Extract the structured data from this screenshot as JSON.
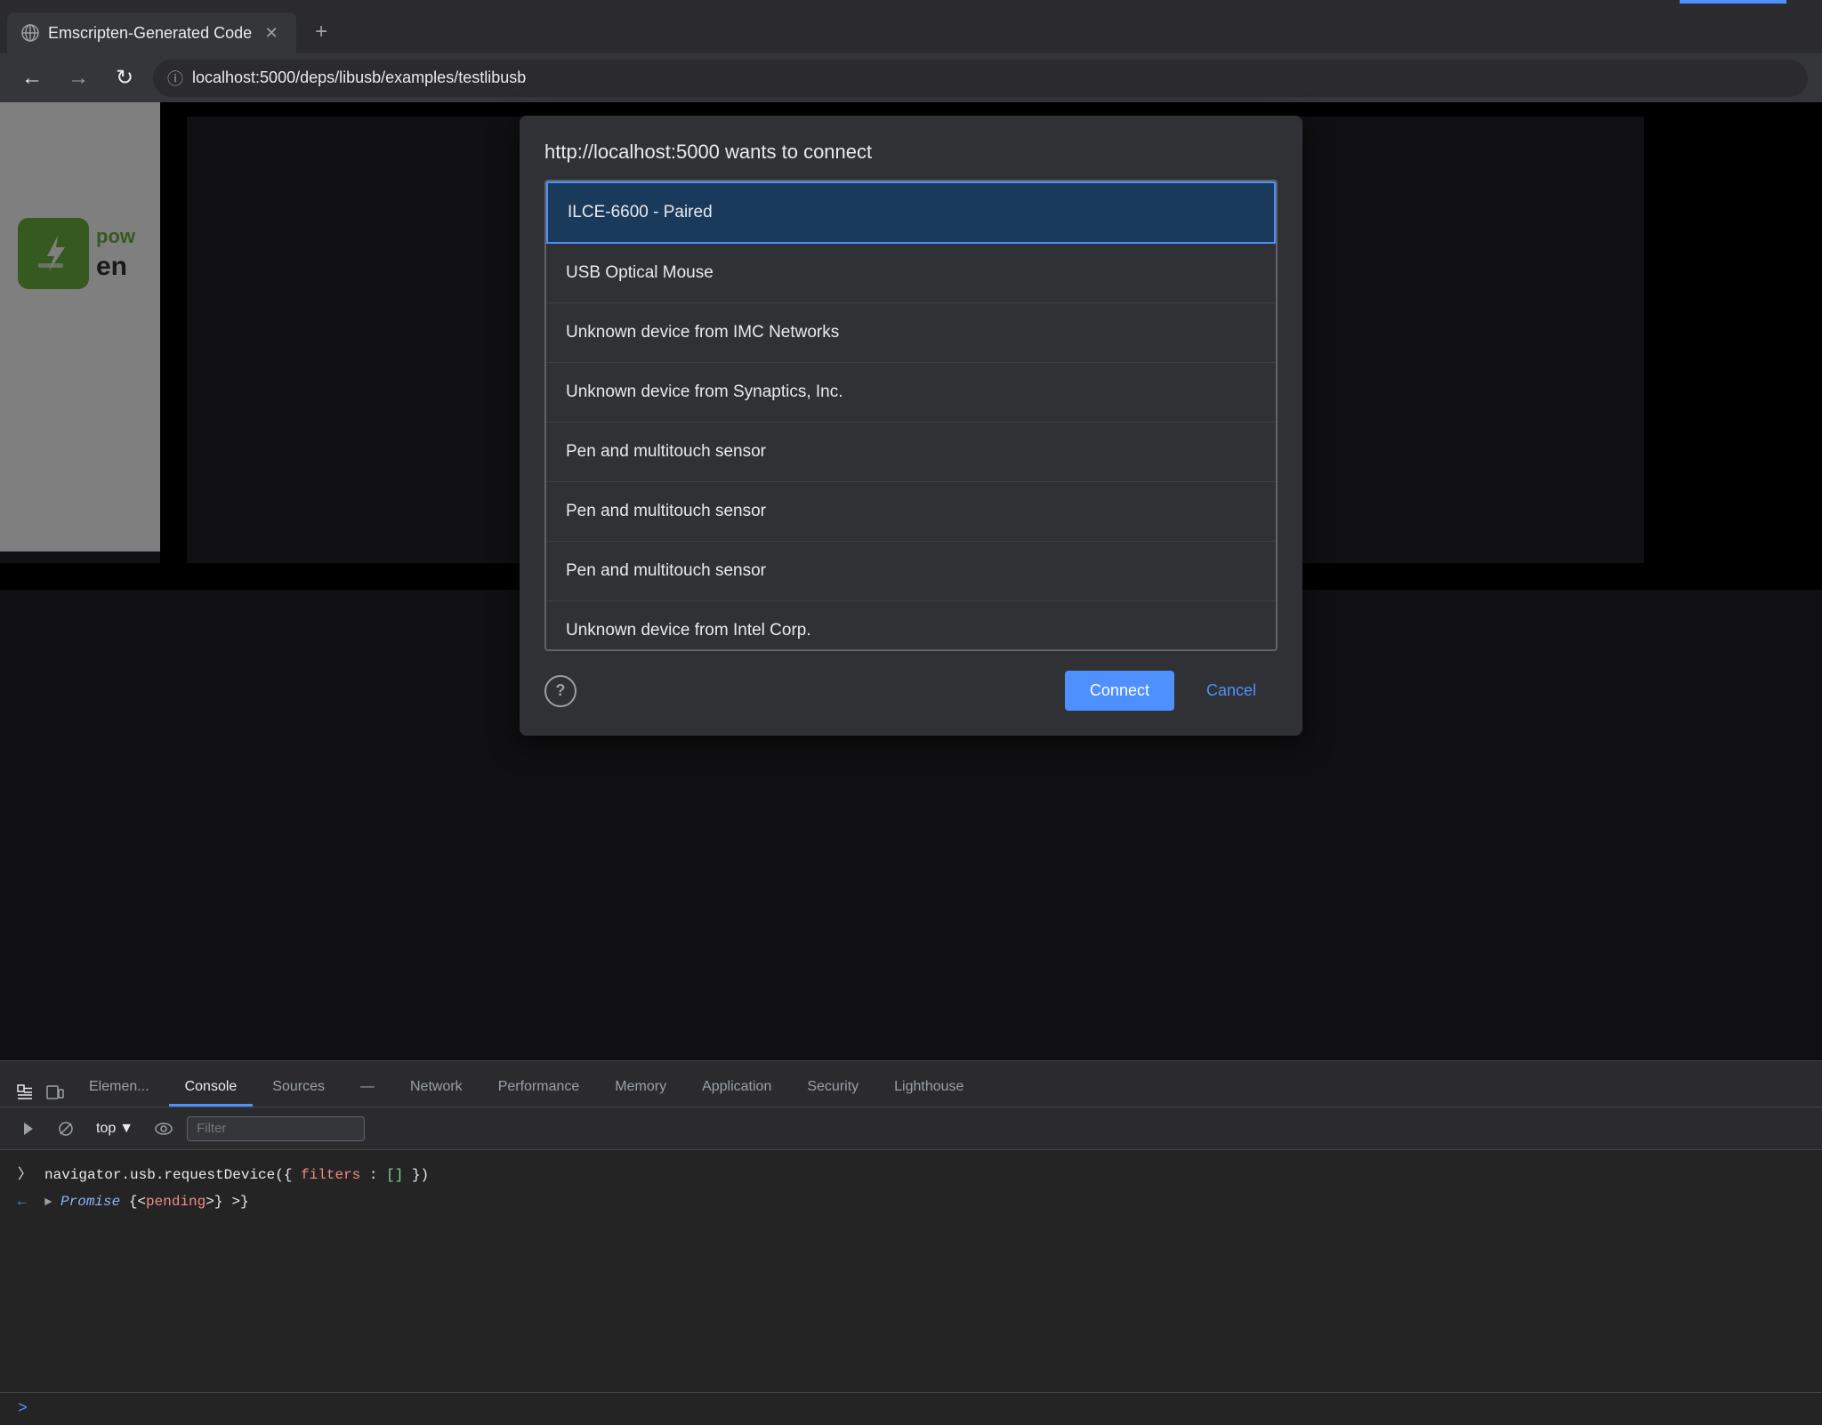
{
  "browser": {
    "tab_title": "Emscripten-Generated Code",
    "address": "localhost:5000/deps/libusb/examples/testlibusb",
    "address_prefix": "localhost:",
    "address_full": "localhost:5000/deps/libusb/examples/testlibusb"
  },
  "dialog": {
    "title": "http://localhost:5000 wants to connect",
    "devices": [
      {
        "name": "ILCE-6600 - Paired",
        "selected": true
      },
      {
        "name": "USB Optical Mouse",
        "selected": false
      },
      {
        "name": "Unknown device from IMC Networks",
        "selected": false
      },
      {
        "name": "Unknown device from Synaptics, Inc.",
        "selected": false
      },
      {
        "name": "Pen and multitouch sensor",
        "selected": false
      },
      {
        "name": "Pen and multitouch sensor",
        "selected": false
      },
      {
        "name": "Pen and multitouch sensor",
        "selected": false
      },
      {
        "name": "Unknown device from Intel Corp.",
        "selected": false
      }
    ],
    "connect_button": "Connect",
    "cancel_button": "Cancel"
  },
  "devtools": {
    "tabs": [
      {
        "label": "Elemen...",
        "active": false
      },
      {
        "label": "Console",
        "active": true
      },
      {
        "label": "Sources",
        "active": false
      },
      {
        "label": "—",
        "active": false
      },
      {
        "label": "Network",
        "active": false
      },
      {
        "label": "Performance",
        "active": false
      },
      {
        "label": "Memory",
        "active": false
      },
      {
        "label": "Application",
        "active": false
      },
      {
        "label": "Security",
        "active": false
      },
      {
        "label": "Lighthouse",
        "active": false
      }
    ],
    "toolbar": {
      "top_selector": "top",
      "filter_placeholder": "Filter"
    },
    "console_lines": [
      {
        "prompt": ">",
        "text": "navigator.usb.requestDevice({ filters: [] })"
      },
      {
        "prompt": "←",
        "text": "▶ Promise {<pending>}"
      }
    ],
    "input_prompt": ">"
  }
}
